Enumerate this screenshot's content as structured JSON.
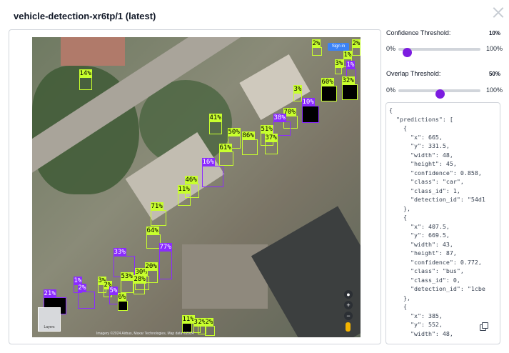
{
  "header": {
    "title": "vehicle-detection-xr6tp/1 (latest)"
  },
  "map": {
    "signin_label": "Sign in",
    "layers_label": "Layers",
    "attribution": "Imagery ©2024 Airbus, Maxar Technologies, Map data ©2024",
    "zoom_in": "+",
    "zoom_out": "−"
  },
  "detections": [
    {
      "label": "14%",
      "color": "lime"
    },
    {
      "label": "2%",
      "color": "lime"
    },
    {
      "label": "2%",
      "color": "lime"
    },
    {
      "label": "1%",
      "color": "lime"
    },
    {
      "label": "3%",
      "color": "lime"
    },
    {
      "label": "1%",
      "color": "purple"
    },
    {
      "label": "60%",
      "color": "lime"
    },
    {
      "label": "32%",
      "color": "lime"
    },
    {
      "label": "3%",
      "color": "lime"
    },
    {
      "label": "10%",
      "color": "purple"
    },
    {
      "label": "70%",
      "color": "lime"
    },
    {
      "label": "38%",
      "color": "purple"
    },
    {
      "label": "41%",
      "color": "lime"
    },
    {
      "label": "50%",
      "color": "lime"
    },
    {
      "label": "86%",
      "color": "lime"
    },
    {
      "label": "51%",
      "color": "lime"
    },
    {
      "label": "37%",
      "color": "lime"
    },
    {
      "label": "61%",
      "color": "lime"
    },
    {
      "label": "16%",
      "color": "purple"
    },
    {
      "label": "46%",
      "color": "lime"
    },
    {
      "label": "11%",
      "color": "lime"
    },
    {
      "label": "71%",
      "color": "lime"
    },
    {
      "label": "64%",
      "color": "lime"
    },
    {
      "label": "33%",
      "color": "purple"
    },
    {
      "label": "77%",
      "color": "purple"
    },
    {
      "label": "30%",
      "color": "lime"
    },
    {
      "label": "20%",
      "color": "lime"
    },
    {
      "label": "53%",
      "color": "lime"
    },
    {
      "label": "28%",
      "color": "lime"
    },
    {
      "label": "21%",
      "color": "purple"
    },
    {
      "label": "1%",
      "color": "purple"
    },
    {
      "label": "2%",
      "color": "purple"
    },
    {
      "label": "3%",
      "color": "lime"
    },
    {
      "label": "2%",
      "color": "lime"
    },
    {
      "label": "5%",
      "color": "purple"
    },
    {
      "label": "6%",
      "color": "lime"
    },
    {
      "label": "11%",
      "color": "lime"
    },
    {
      "label": "3%",
      "color": "lime"
    },
    {
      "label": "2%",
      "color": "lime"
    },
    {
      "label": "2%",
      "color": "lime"
    }
  ],
  "controls": {
    "confidence": {
      "label": "Confidence Threshold:",
      "value_text": "10%",
      "min": "0%",
      "max": "100%",
      "value": 10
    },
    "overlap": {
      "label": "Overlap Threshold:",
      "value_text": "50%",
      "min": "0%",
      "max": "100%",
      "value": 50
    }
  },
  "json_output": "{\n  \"predictions\": [\n    {\n      \"x\": 665,\n      \"y\": 331.5,\n      \"width\": 48,\n      \"height\": 45,\n      \"confidence\": 0.858,\n      \"class\": \"car\",\n      \"class_id\": 1,\n      \"detection_id\": \"54d1\n    },\n    {\n      \"x\": 407.5,\n      \"y\": 669.5,\n      \"width\": 43,\n      \"height\": 87,\n      \"confidence\": 0.772,\n      \"class\": \"bus\",\n      \"class_id\": 0,\n      \"detection_id\": \"1cbe\n    },\n    {\n      \"x\": 385,\n      \"y\": 552,\n      \"width\": 48,",
  "colors": {
    "accent": "#7c1ce0",
    "box_lime": "#c8ff2e",
    "box_purple": "#8b2bff"
  }
}
